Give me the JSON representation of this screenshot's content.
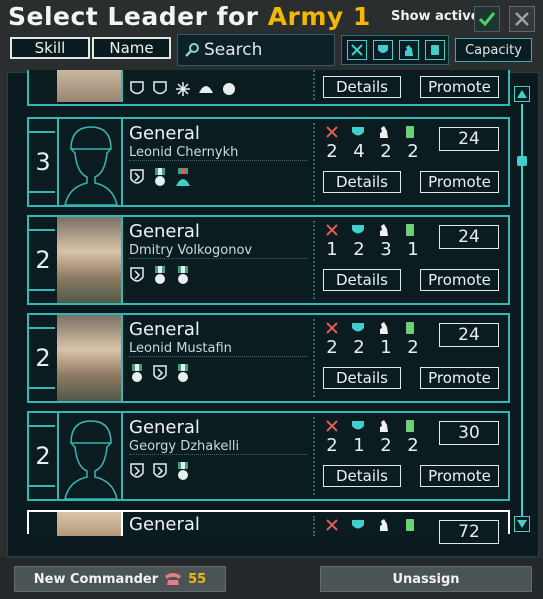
{
  "header": {
    "title_prefix": "Select Leader for ",
    "title_army": "Army 1",
    "show_active_label": "Show active",
    "show_active_checked": true
  },
  "toolbar": {
    "skill_label": "Skill",
    "name_label": "Name",
    "search_placeholder": "Search",
    "capacity_label": "Capacity"
  },
  "leaders": [
    {
      "rank_title": "General",
      "name": "Leonid Chernykh",
      "rank": "3",
      "stats": {
        "attack": "2",
        "defense": "4",
        "planning": "2",
        "logistics": "2"
      },
      "cost": "24",
      "details_label": "Details",
      "promote_label": "Promote",
      "portrait": "silhouette",
      "traits": [
        "trait-shield-icon",
        "trait-medal-icon",
        "trait-helmet-icon"
      ]
    },
    {
      "rank_title": "General",
      "name": "Dmitry Volkogonov",
      "rank": "2",
      "stats": {
        "attack": "1",
        "defense": "2",
        "planning": "3",
        "logistics": "1"
      },
      "cost": "24",
      "details_label": "Details",
      "promote_label": "Promote",
      "portrait": "photo",
      "traits": [
        "trait-shield-icon",
        "trait-medal-icon",
        "trait-medal-icon"
      ]
    },
    {
      "rank_title": "General",
      "name": "Leonid Mustafin",
      "rank": "2",
      "stats": {
        "attack": "2",
        "defense": "2",
        "planning": "1",
        "logistics": "2"
      },
      "cost": "24",
      "details_label": "Details",
      "promote_label": "Promote",
      "portrait": "photo",
      "traits": [
        "trait-medal-icon",
        "trait-shield-icon",
        "trait-medal-icon"
      ]
    },
    {
      "rank_title": "General",
      "name": "Georgy Dzhakelli",
      "rank": "2",
      "stats": {
        "attack": "2",
        "defense": "1",
        "planning": "2",
        "logistics": "2"
      },
      "cost": "30",
      "details_label": "Details",
      "promote_label": "Promote",
      "portrait": "silhouette",
      "traits": [
        "trait-shield-icon",
        "trait-shield-icon",
        "trait-medal-icon"
      ]
    }
  ],
  "partial_top": {
    "details_label": "Details",
    "promote_label": "Promote"
  },
  "partial_bottom": {
    "rank_title": "General",
    "cost": "72"
  },
  "footer": {
    "new_commander_label": "New Commander",
    "command_power": "55",
    "unassign_label": "Unassign"
  },
  "colors": {
    "accent": "#35b7b2",
    "army": "#f5b800",
    "attack": "#e05a5a",
    "logistics": "#6fd07a"
  }
}
